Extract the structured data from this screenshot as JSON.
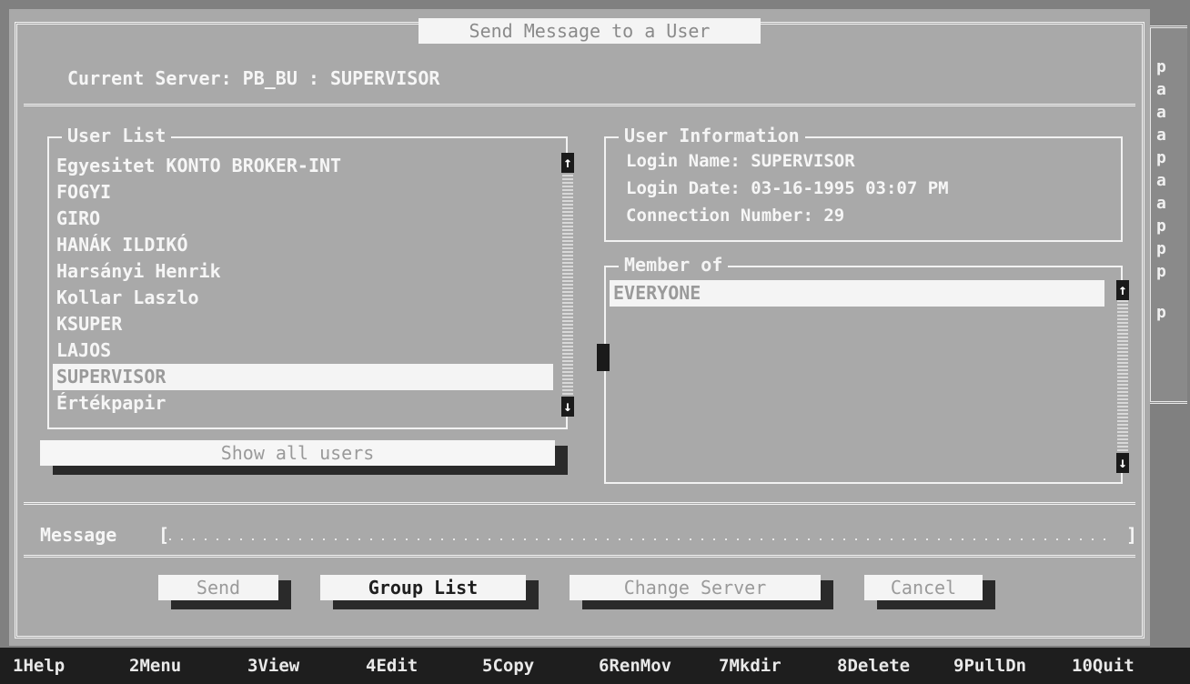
{
  "dialog": {
    "title": "Send Message to a User",
    "server_line": "Current Server: PB_BU : SUPERVISOR"
  },
  "right_strip_chars": [
    "p",
    "a",
    "a",
    "a",
    "p",
    "a",
    "a",
    "p",
    "p",
    "p",
    "p"
  ],
  "user_list": {
    "label": "User List",
    "items": [
      "Egyesitet KONTO BROKER-INT",
      "FOGYI",
      "GIRO",
      "HANÁK ILDIKÓ",
      "Harsányi Henrik",
      "Kollar Laszlo",
      "KSUPER",
      "LAJOS",
      "SUPERVISOR",
      "Értékpapir"
    ],
    "selected_index": 8,
    "show_all_button": "Show all users"
  },
  "user_info": {
    "label": "User Information",
    "login_name": "Login Name: SUPERVISOR",
    "login_date": "Login Date: 03-16-1995  03:07 PM",
    "connection": "Connection Number: 29"
  },
  "member_of": {
    "label": "Member of",
    "items": [
      "EVERYONE"
    ],
    "selected_index": 0
  },
  "message": {
    "label": "Message",
    "open_bracket": "[",
    "close_bracket": "]",
    "value": ""
  },
  "buttons": {
    "send": "Send",
    "group_list": "Group List",
    "change_server": "Change Server",
    "cancel": "Cancel"
  },
  "function_keys": [
    "1Help",
    "2Menu",
    "3View",
    "4Edit",
    "5Copy",
    "6RenMov",
    "7Mkdir",
    "8Delete",
    "9PullDn",
    "10Quit"
  ],
  "colors": {
    "dialog_bg": "#a9a9a9",
    "selection_bg": "#f4f4f4",
    "text": "#f6f6f6",
    "status_bar_bg": "#1e1e1e"
  }
}
